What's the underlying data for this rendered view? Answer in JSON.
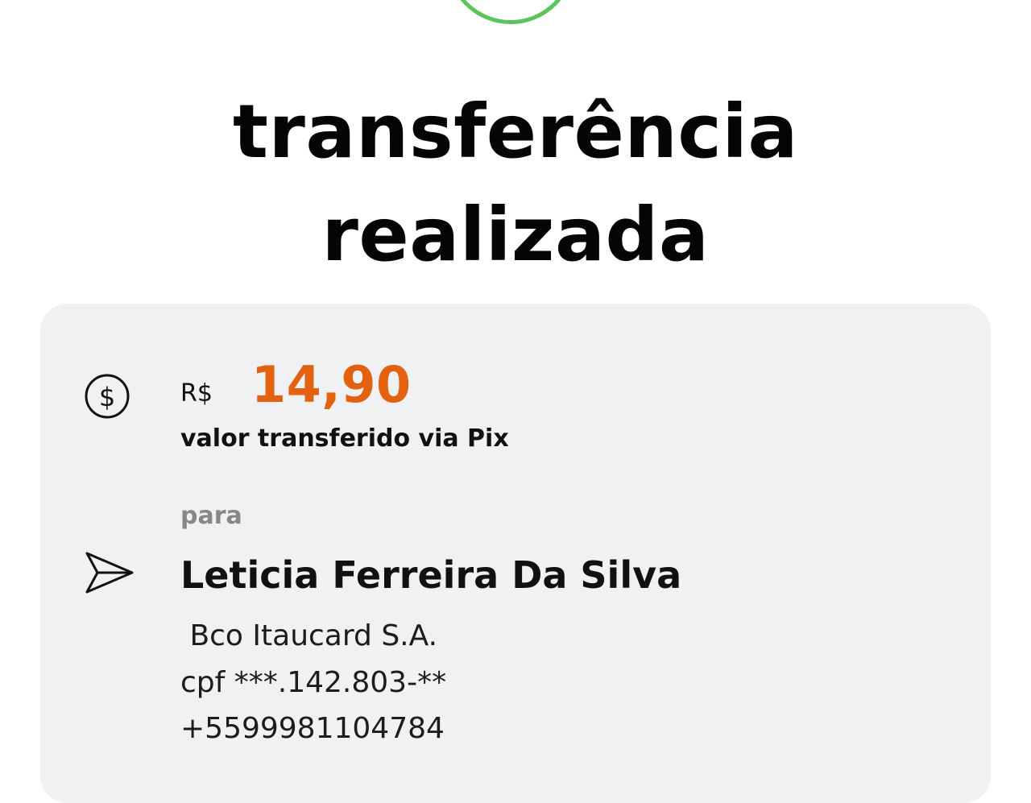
{
  "header": {
    "title_line1": "transferência",
    "title_line2": "realizada"
  },
  "colors": {
    "success": "#5cc45a",
    "amount": "#e3620f",
    "card_background": "#f0f1f3",
    "muted_text": "#8a8684"
  },
  "transfer": {
    "currency": "R$",
    "amount": "14,90",
    "amount_caption": "valor transferido via Pix",
    "amount_icon": "dollar-circle-icon"
  },
  "recipient": {
    "label": "para",
    "icon": "send-icon",
    "name": "Leticia Ferreira Da Silva",
    "bank": " Bco Itaucard S.A.",
    "cpf": "cpf ***.142.803-**",
    "phone": "+5599981104784"
  }
}
